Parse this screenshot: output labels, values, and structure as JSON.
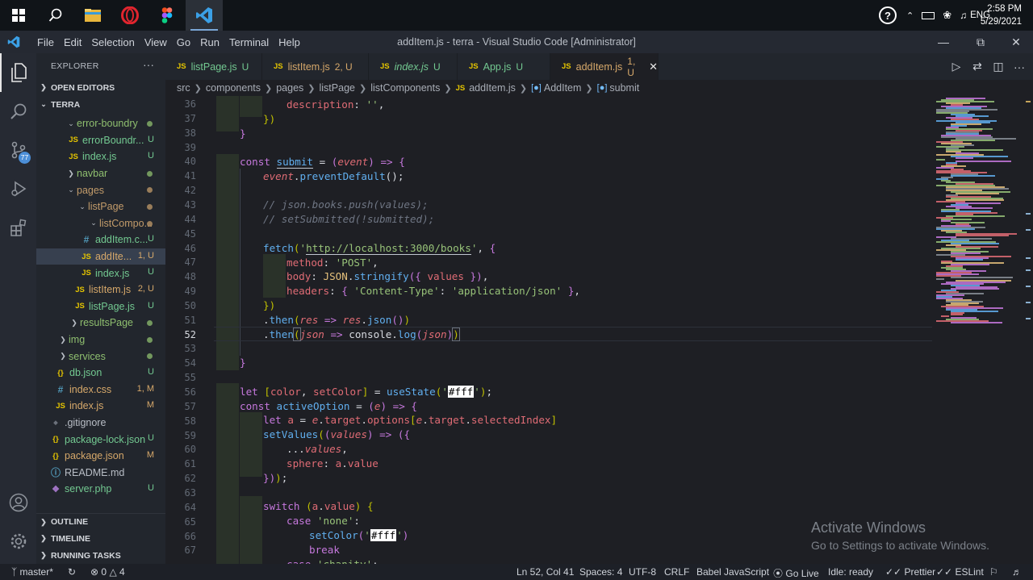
{
  "taskbar": {
    "time": "2:58 PM",
    "date": "5/29/2021",
    "lang": "ENG"
  },
  "titlebar": {
    "menu": [
      "File",
      "Edit",
      "Selection",
      "View",
      "Go",
      "Run",
      "Terminal",
      "Help"
    ],
    "title": "addItem.js - terra - Visual Studio Code [Administrator]"
  },
  "activity": {
    "badge": "77"
  },
  "sidebar": {
    "header": "EXPLORER",
    "open_editors": "OPEN EDITORS",
    "root": "TERRA",
    "outline": "OUTLINE",
    "timeline": "TIMELINE",
    "running_tasks": "RUNNING TASKS",
    "items": [
      {
        "label": "error-boundry",
        "kind": "folder",
        "status": "dot",
        "color": "#8fbf6f"
      },
      {
        "label": "errorBoundr...",
        "kind": "js",
        "status": "U",
        "color": "#73c991"
      },
      {
        "label": "index.js",
        "kind": "js",
        "status": "U",
        "color": "#73c991"
      },
      {
        "label": "navbar",
        "kind": "folder-closed",
        "status": "dot",
        "color": "#8fbf6f"
      },
      {
        "label": "pages",
        "kind": "folder",
        "status": "dot",
        "color": "#c29b6a"
      },
      {
        "label": "listPage",
        "kind": "folder",
        "status": "dot",
        "color": "#c29b6a"
      },
      {
        "label": "listCompo...",
        "kind": "folder",
        "status": "dot",
        "color": "#c29b6a"
      },
      {
        "label": "addItem.c...",
        "kind": "css",
        "status": "U",
        "color": "#73c991"
      },
      {
        "label": "addIte...",
        "kind": "js",
        "status": "1, U",
        "color": "#d6a86a"
      },
      {
        "label": "index.js",
        "kind": "js",
        "status": "U",
        "color": "#73c991"
      },
      {
        "label": "listItem.js",
        "kind": "js",
        "status": "2, U",
        "color": "#d6a86a"
      },
      {
        "label": "listPage.js",
        "kind": "js",
        "status": "U",
        "color": "#73c991"
      },
      {
        "label": "resultsPage",
        "kind": "folder-closed",
        "status": "dot",
        "color": "#8fbf6f"
      },
      {
        "label": "img",
        "kind": "folder-closed",
        "status": "dot",
        "color": "#8fbf6f"
      },
      {
        "label": "services",
        "kind": "folder-closed",
        "status": "dot",
        "color": "#8fbf6f"
      },
      {
        "label": "db.json",
        "kind": "json",
        "status": "U",
        "color": "#73c991"
      },
      {
        "label": "index.css",
        "kind": "css",
        "status": "1, M",
        "color": "#d6a86a"
      },
      {
        "label": "index.js",
        "kind": "js",
        "status": "M",
        "color": "#d6a86a"
      },
      {
        "label": ".gitignore",
        "kind": "git",
        "status": "",
        "color": "#b9bec6"
      },
      {
        "label": "package-lock.json",
        "kind": "json",
        "status": "U",
        "color": "#73c991"
      },
      {
        "label": "package.json",
        "kind": "json",
        "status": "M",
        "color": "#d6a86a"
      },
      {
        "label": "README.md",
        "kind": "info",
        "status": "",
        "color": "#b9bec6"
      },
      {
        "label": "server.php",
        "kind": "php",
        "status": "U",
        "color": "#73c991"
      }
    ]
  },
  "tabs": [
    {
      "label": "listPage.js",
      "status": "U",
      "italic": false,
      "color": "#73c991"
    },
    {
      "label": "listItem.js",
      "status": "2, U",
      "italic": false,
      "color": "#d6a86a"
    },
    {
      "label": "index.js",
      "status": "U",
      "italic": true,
      "color": "#73c991"
    },
    {
      "label": "App.js",
      "status": "U",
      "italic": false,
      "color": "#73c991"
    },
    {
      "label": "addItem.js",
      "status": "1, U",
      "italic": false,
      "color": "#d6a86a"
    }
  ],
  "breadcrumb": [
    "src",
    "components",
    "pages",
    "listPage",
    "listComponents",
    "addItem.js",
    "AddItem",
    "submit"
  ],
  "editor": {
    "line_numbers": [
      "36",
      "37",
      "38",
      "39",
      "40",
      "41",
      "42",
      "43",
      "44",
      "45",
      "46",
      "47",
      "48",
      "49",
      "50",
      "51",
      "52",
      "53",
      "54",
      "55",
      "56",
      "57",
      "58",
      "59",
      "60",
      "61",
      "62",
      "63",
      "64",
      "65",
      "66",
      "67"
    ],
    "current_line": "52"
  },
  "watermark": {
    "title": "Activate Windows",
    "subtitle": "Go to Settings to activate Windows."
  },
  "status": {
    "branch": "master*",
    "errors": "0",
    "warnings": "4",
    "position": "Ln 52, Col 41",
    "spaces": "Spaces: 4",
    "encoding": "UTF-8",
    "eol": "CRLF",
    "language": "Babel JavaScript",
    "golive": "Go Live",
    "idle": "Idle: ready",
    "prettier": "Prettier",
    "eslint": "ESLint"
  }
}
